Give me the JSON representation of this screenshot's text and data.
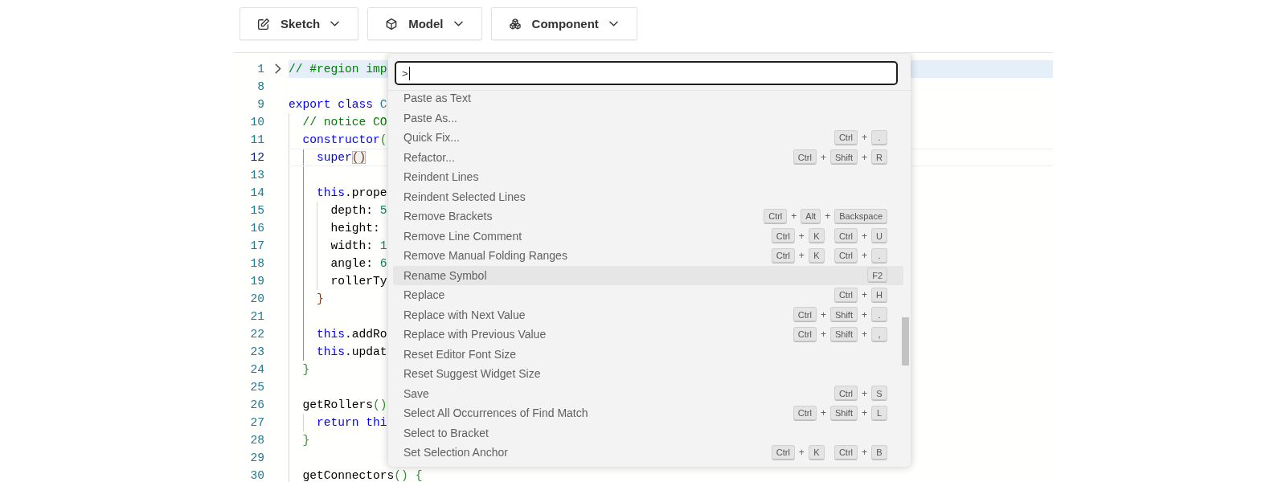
{
  "toolbar": [
    {
      "label": "Sketch",
      "kind": "sketch"
    },
    {
      "label": "Model",
      "kind": "model"
    },
    {
      "label": "Component",
      "kind": "component"
    }
  ],
  "editor": {
    "lines": [
      {
        "number": "1",
        "tokens": [
          {
            "text": "// #region imp",
            "kind": "comment"
          }
        ],
        "folded": true,
        "current": false
      },
      {
        "number": "8",
        "folded": false,
        "current": false
      },
      {
        "number": "9",
        "tokens": [
          {
            "text": "export class ",
            "kind": "keyword"
          },
          {
            "text": "C",
            "kind": "type"
          }
        ],
        "folded": false,
        "current": false
      },
      {
        "number": "10",
        "tokens": [
          {
            "text": "  // notice CO",
            "kind": "comment"
          }
        ],
        "folded": false,
        "current": false
      },
      {
        "number": "11",
        "tokens": [
          {
            "text": "  constructor",
            "kind": "keyword"
          },
          {
            "text": "(",
            "kind": "bracket2"
          }
        ],
        "folded": false,
        "current": false
      },
      {
        "number": "12",
        "tokens": [
          {
            "text": "    super",
            "kind": "keyword"
          },
          {
            "text": "()",
            "kind": "bracket3",
            "matched": true
          }
        ],
        "folded": false,
        "current": true
      },
      {
        "number": "13",
        "folded": false,
        "current": false
      },
      {
        "number": "14",
        "tokens": [
          {
            "text": "    this",
            "kind": "keyword"
          },
          {
            "text": ".prope",
            "kind": "plain"
          }
        ],
        "folded": false,
        "current": false
      },
      {
        "number": "15",
        "tokens": [
          {
            "text": "      depth: ",
            "kind": "plain"
          },
          {
            "text": "5",
            "kind": "number"
          }
        ],
        "folded": false,
        "current": false
      },
      {
        "number": "16",
        "tokens": [
          {
            "text": "      height:",
            "kind": "plain"
          }
        ],
        "folded": false,
        "current": false
      },
      {
        "number": "17",
        "tokens": [
          {
            "text": "      width: ",
            "kind": "plain"
          },
          {
            "text": "1",
            "kind": "number"
          }
        ],
        "folded": false,
        "current": false
      },
      {
        "number": "18",
        "tokens": [
          {
            "text": "      angle: ",
            "kind": "plain"
          },
          {
            "text": "6",
            "kind": "number"
          }
        ],
        "folded": false,
        "current": false
      },
      {
        "number": "19",
        "tokens": [
          {
            "text": "      rollerTy",
            "kind": "plain"
          }
        ],
        "folded": false,
        "current": false
      },
      {
        "number": "20",
        "tokens": [
          {
            "text": "    }",
            "kind": "bracket3"
          }
        ],
        "folded": false,
        "current": false
      },
      {
        "number": "21",
        "folded": false,
        "current": false
      },
      {
        "number": "22",
        "tokens": [
          {
            "text": "    this",
            "kind": "keyword"
          },
          {
            "text": ".addRo",
            "kind": "plain"
          }
        ],
        "folded": false,
        "current": false
      },
      {
        "number": "23",
        "tokens": [
          {
            "text": "    this",
            "kind": "keyword"
          },
          {
            "text": ".updat",
            "kind": "plain"
          }
        ],
        "folded": false,
        "current": false
      },
      {
        "number": "24",
        "tokens": [
          {
            "text": "  }",
            "kind": "bracket2"
          }
        ],
        "folded": false,
        "current": false
      },
      {
        "number": "25",
        "folded": false,
        "current": false
      },
      {
        "number": "26",
        "tokens": [
          {
            "text": "  getRollers",
            "kind": "plain"
          },
          {
            "text": "()",
            "kind": "bracket2"
          }
        ],
        "folded": false,
        "current": false
      },
      {
        "number": "27",
        "tokens": [
          {
            "text": "    return thi",
            "kind": "keyword"
          }
        ],
        "folded": false,
        "current": false
      },
      {
        "number": "28",
        "tokens": [
          {
            "text": "  }",
            "kind": "bracket2"
          }
        ],
        "folded": false,
        "current": false
      },
      {
        "number": "29",
        "folded": false,
        "current": false
      },
      {
        "number": "30",
        "tokens": [
          {
            "text": "  getConnectors",
            "kind": "plain"
          },
          {
            "text": "() {",
            "kind": "bracket2"
          }
        ],
        "folded": false,
        "current": false
      }
    ]
  },
  "command_palette": {
    "input": {
      "value": ">"
    },
    "commands": [
      {
        "label": "Paste as Text",
        "selected": false
      },
      {
        "label": "Paste As...",
        "selected": false
      },
      {
        "label": "Quick Fix...",
        "selected": false,
        "keybinding": [
          [
            "Ctrl",
            "+",
            "."
          ]
        ]
      },
      {
        "label": "Refactor...",
        "selected": false,
        "keybinding": [
          [
            "Ctrl",
            "+",
            "Shift",
            "+",
            "R"
          ]
        ]
      },
      {
        "label": "Reindent Lines",
        "selected": false
      },
      {
        "label": "Reindent Selected Lines",
        "selected": false
      },
      {
        "label": "Remove Brackets",
        "selected": false,
        "keybinding": [
          [
            "Ctrl",
            "+",
            "Alt",
            "+",
            "Backspace"
          ]
        ]
      },
      {
        "label": "Remove Line Comment",
        "selected": false,
        "keybinding": [
          [
            "Ctrl",
            "+",
            "K"
          ],
          [
            "Ctrl",
            "+",
            "U"
          ]
        ]
      },
      {
        "label": "Remove Manual Folding Ranges",
        "selected": false,
        "keybinding": [
          [
            "Ctrl",
            "+",
            "K"
          ],
          [
            "Ctrl",
            "+",
            "."
          ]
        ]
      },
      {
        "label": "Rename Symbol",
        "selected": true,
        "keybinding": [
          [
            "F2"
          ]
        ]
      },
      {
        "label": "Replace",
        "selected": false,
        "keybinding": [
          [
            "Ctrl",
            "+",
            "H"
          ]
        ]
      },
      {
        "label": "Replace with Next Value",
        "selected": false,
        "keybinding": [
          [
            "Ctrl",
            "+",
            "Shift",
            "+",
            "."
          ]
        ]
      },
      {
        "label": "Replace with Previous Value",
        "selected": false,
        "keybinding": [
          [
            "Ctrl",
            "+",
            "Shift",
            "+",
            ","
          ]
        ]
      },
      {
        "label": "Reset Editor Font Size",
        "selected": false
      },
      {
        "label": "Reset Suggest Widget Size",
        "selected": false
      },
      {
        "label": "Save",
        "selected": false,
        "keybinding": [
          [
            "Ctrl",
            "+",
            "S"
          ]
        ]
      },
      {
        "label": "Select All Occurrences of Find Match",
        "selected": false,
        "keybinding": [
          [
            "Ctrl",
            "+",
            "Shift",
            "+",
            "L"
          ]
        ]
      },
      {
        "label": "Select to Bracket",
        "selected": false
      },
      {
        "label": "Set Selection Anchor",
        "selected": false,
        "keybinding": [
          [
            "Ctrl",
            "+",
            "K"
          ],
          [
            "Ctrl",
            "+",
            "B"
          ]
        ]
      }
    ]
  }
}
